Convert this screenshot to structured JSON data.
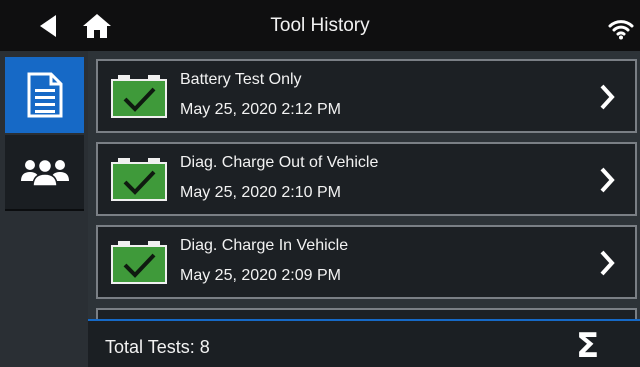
{
  "header": {
    "title": "Tool History",
    "back_icon": "back-arrow-icon",
    "home_icon": "home-icon",
    "wifi_icon": "wifi-icon"
  },
  "sidebar": {
    "items": [
      {
        "icon": "document-icon",
        "active": true
      },
      {
        "icon": "users-group-icon",
        "active": false
      }
    ]
  },
  "tests": [
    {
      "name": "Battery Test Only",
      "date": "May 25, 2020 2:12 PM",
      "status_icon": "battery-check-icon"
    },
    {
      "name": "Diag. Charge Out of Vehicle",
      "date": "May 25, 2020 2:10 PM",
      "status_icon": "battery-check-icon"
    },
    {
      "name": "Diag. Charge In Vehicle",
      "date": "May 25, 2020 2:09 PM",
      "status_icon": "battery-check-icon"
    }
  ],
  "footer": {
    "total_label": "Total Tests: 8",
    "summary_symbol": "Σ"
  },
  "colors": {
    "accent": "#1669c6",
    "battery_green": "#3f9a3a",
    "background": "#2b3035"
  }
}
